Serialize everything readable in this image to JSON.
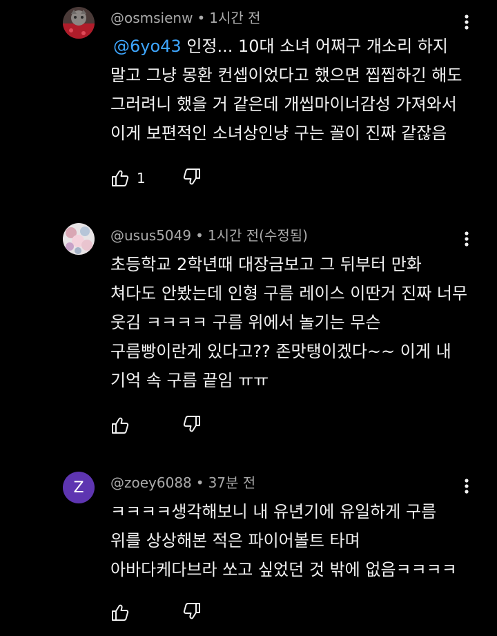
{
  "comments": [
    {
      "author": "@osmsienw",
      "time": "1시간 전",
      "mention": "@6yo43",
      "lines": [
        " 인정... 10대 소녀 어쩌구 개소리 하지",
        "말고 그냥 몽환 컨셉이었다고 했으면 찝찝하긴 해도",
        "그러려니 했을 거 같은데 개씹마이너감성 가져와서",
        "이게 보편적인 소녀상인냥 구는 꼴이 진짜 같잖음"
      ],
      "like_count": "1"
    },
    {
      "author": "@usus5049",
      "time": "1시간 전(수정됨)",
      "lines": [
        "초등학교 2학년때 대장금보고 그 뒤부터 만화",
        "쳐다도 안봤는데 인형 구름 레이스 이딴거 진짜 너무",
        "웃김 ㅋㅋㅋㅋ 구름 위에서 놀기는 무슨",
        "구름빵이란게 있다고?? 존맛탱이겠다~~ 이게 내",
        "기억 속 구름 끝임 ㅠㅠ"
      ],
      "like_count": ""
    },
    {
      "author": "@zoey6088",
      "time": "37분 전",
      "avatar_letter": "Z",
      "avatar_color": "#5e35b1",
      "lines": [
        "ㅋㅋㅋㅋ생각해보니 내 유년기에 유일하게 구름",
        "위를 상상해본 적은 파이어볼트 타며",
        "아바다케다브라 쏘고 싶었던 것 밖에 없음ㅋㅋㅋㅋ"
      ],
      "like_count": ""
    }
  ],
  "separator": "•",
  "icons": {
    "like": "thumbs-up-icon",
    "dislike": "thumbs-down-icon",
    "menu": "more-vertical-icon"
  },
  "colors": {
    "background": "#000000",
    "text": "#f1f1f1",
    "meta": "#aaaaaa",
    "mention": "#3ea6ff"
  }
}
